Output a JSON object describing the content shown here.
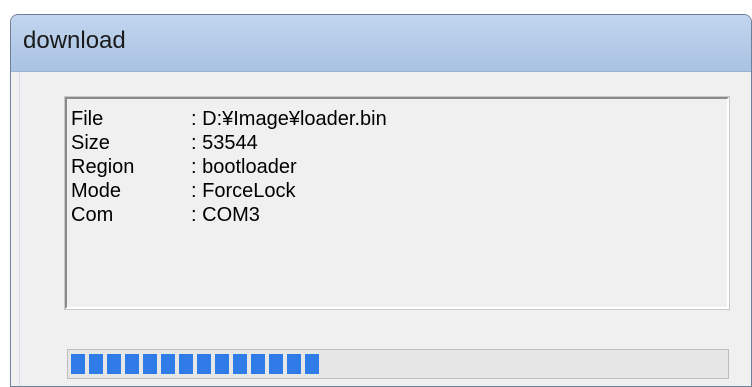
{
  "window": {
    "title": "download"
  },
  "info": {
    "rows": [
      {
        "label": "File",
        "value": "D:¥Image¥loader.bin"
      },
      {
        "label": "Size",
        "value": "53544"
      },
      {
        "label": "Region",
        "value": "bootloader"
      },
      {
        "label": "Mode",
        "value": "ForceLock"
      },
      {
        "label": "Com",
        "value": "COM3"
      }
    ]
  },
  "progress": {
    "fraction": 0.38,
    "color": "#2f7ce8"
  }
}
